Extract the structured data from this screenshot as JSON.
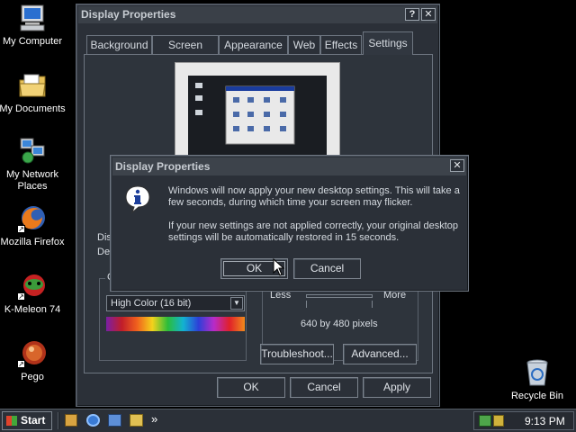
{
  "desktop": {
    "icons": [
      {
        "label": "My Computer"
      },
      {
        "label": "My Documents"
      },
      {
        "label": "My Network Places"
      },
      {
        "label": "Mozilla Firefox"
      },
      {
        "label": "K-Meleon 74"
      },
      {
        "label": "Pego"
      }
    ],
    "recycle_bin": "Recycle Bin"
  },
  "display_window": {
    "title": "Display Properties",
    "help_glyph": "?",
    "close_glyph": "✕",
    "tabs": [
      "Background",
      "Screen Saver",
      "Appearance",
      "Web",
      "Effects",
      "Settings"
    ],
    "active_tab": "Settings",
    "display_label_partial": "Dis",
    "display_value_partial": "Def",
    "colors_group_partial": "C",
    "color_quality_value": "High Color (16 bit)",
    "resolution_less": "Less",
    "resolution_more": "More",
    "resolution_value": "640 by 480 pixels",
    "troubleshoot_button": "Troubleshoot...",
    "advanced_button": "Advanced...",
    "ok_button": "OK",
    "cancel_button": "Cancel",
    "apply_button": "Apply"
  },
  "confirm_dialog": {
    "title": "Display Properties",
    "close_glyph": "✕",
    "icon": "info-icon",
    "message_1": "Windows will now apply your new desktop settings. This will take a few seconds, during which time your screen may flicker.",
    "message_2": "If your new settings are not applied correctly, your original desktop settings will be automatically restored in 15 seconds.",
    "ok_button": "OK",
    "cancel_button": "Cancel"
  },
  "taskbar": {
    "start_label": "Start",
    "chevron": "»",
    "clock": "9:13 PM"
  },
  "colors": {
    "window_bg": "#2b3038",
    "title_bg": "#3a4048",
    "info_icon_blue": "#1d3f9b"
  }
}
